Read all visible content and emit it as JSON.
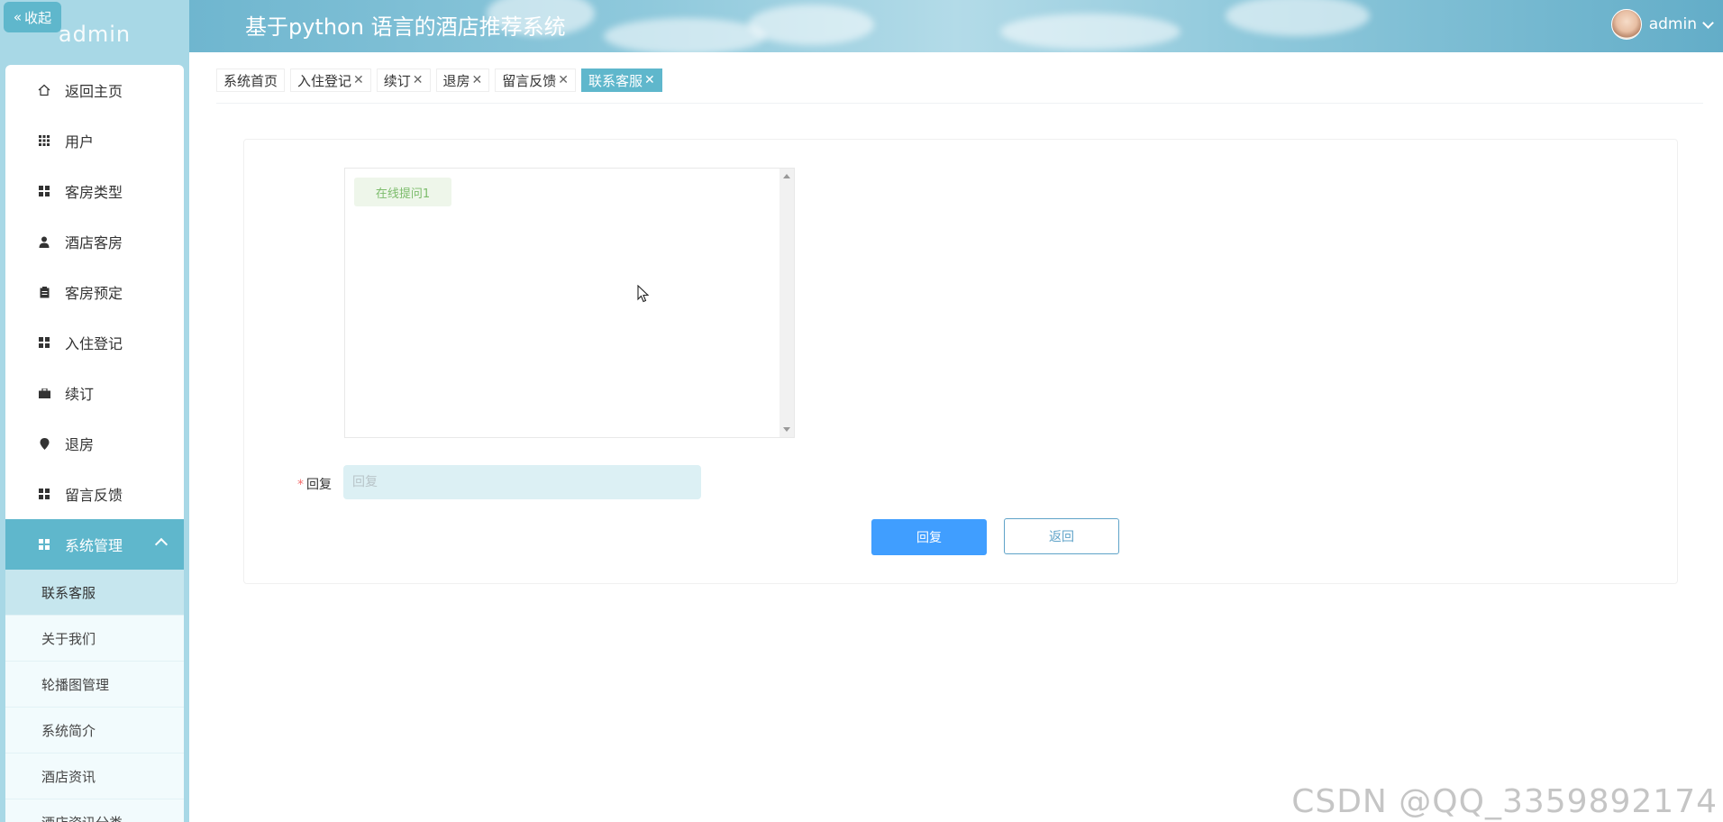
{
  "sidebar": {
    "collapse_label": "收起",
    "username": "admin",
    "menu": [
      {
        "label": "返回主页",
        "icon": "home-icon"
      },
      {
        "label": "用户",
        "icon": "grid-icon"
      },
      {
        "label": "客房类型",
        "icon": "grid-icon"
      },
      {
        "label": "酒店客房",
        "icon": "user-icon"
      },
      {
        "label": "客房预定",
        "icon": "clipboard-icon"
      },
      {
        "label": "入住登记",
        "icon": "grid-icon"
      },
      {
        "label": "续订",
        "icon": "briefcase-icon"
      },
      {
        "label": "退房",
        "icon": "pin-icon"
      },
      {
        "label": "留言反馈",
        "icon": "grid-icon"
      },
      {
        "label": "系统管理",
        "icon": "grid-icon"
      }
    ],
    "submenu": [
      {
        "label": "联系客服"
      },
      {
        "label": "关于我们"
      },
      {
        "label": "轮播图管理"
      },
      {
        "label": "系统简介"
      },
      {
        "label": "酒店资讯"
      },
      {
        "label": "酒店资讯分类"
      }
    ]
  },
  "header": {
    "title": "基于python 语言的酒店推荐系统",
    "user": "admin"
  },
  "tabs": [
    {
      "label": "系统首页",
      "closable": false
    },
    {
      "label": "入住登记",
      "closable": true
    },
    {
      "label": "续订",
      "closable": true
    },
    {
      "label": "退房",
      "closable": true
    },
    {
      "label": "留言反馈",
      "closable": true
    },
    {
      "label": "联系客服",
      "closable": true,
      "active": true
    }
  ],
  "form": {
    "chat_message": "在线提问1",
    "reply_label": "回复",
    "reply_placeholder": "回复",
    "reply_value": "",
    "submit_label": "回复",
    "back_label": "返回"
  },
  "watermark": "CSDN @QQ_3359892174",
  "colors": {
    "accent": "#5fb7cc",
    "primary_button": "#409eff",
    "sidebar_bg": "#a8d8e6"
  }
}
